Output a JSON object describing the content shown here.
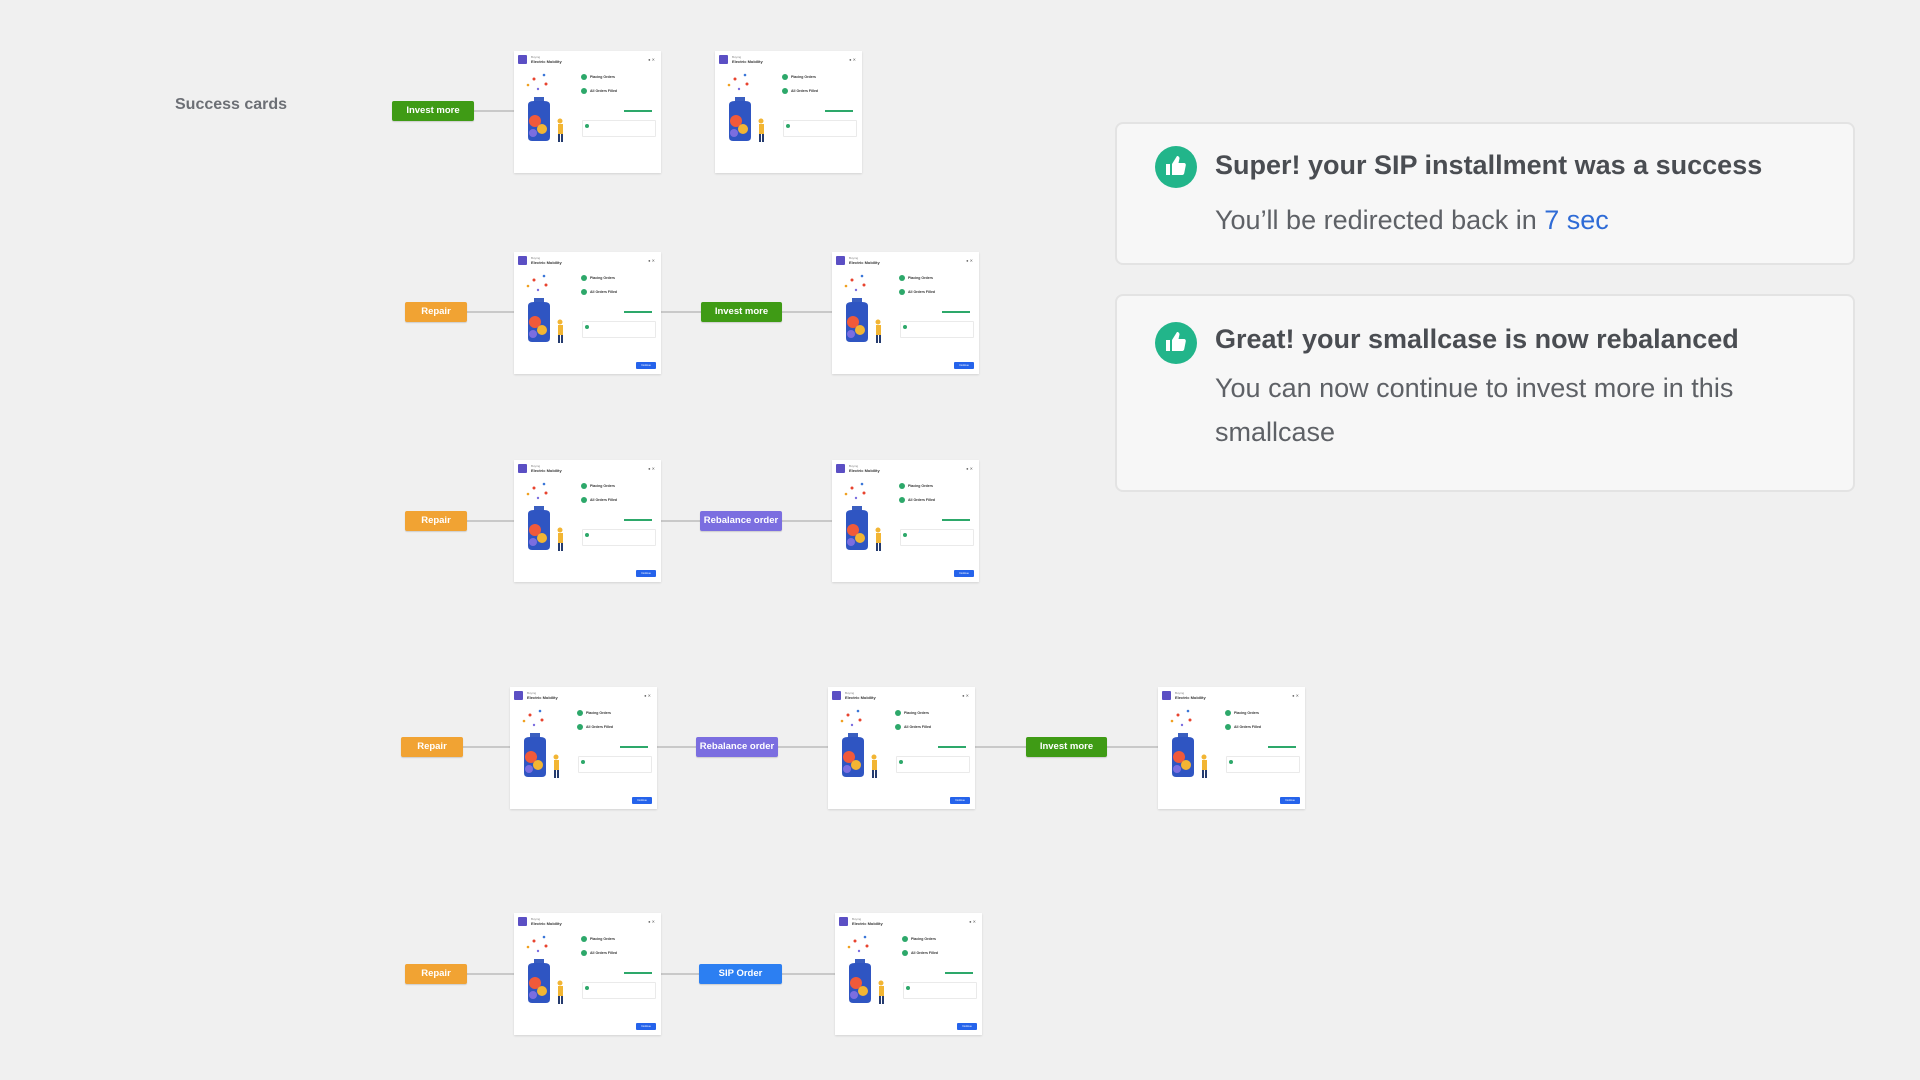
{
  "section_title": "Success cards",
  "colors": {
    "invest_more": "#3f9b15",
    "repair": "#f1a333",
    "rebalance_order": "#7b6ee0",
    "sip_order": "#2c7ff2",
    "success_icon": "#22b58a"
  },
  "card": {
    "subtitle": "Buying",
    "name": "Electric Mobility",
    "step_placing": "Placing Orders",
    "step_filled": "All Orders Filled",
    "continue_label": "Continue"
  },
  "flows": [
    {
      "steps": [
        "Invest more"
      ]
    },
    {
      "steps": [
        "Repair",
        "Invest more"
      ]
    },
    {
      "steps": [
        "Repair",
        "Rebalance order"
      ]
    },
    {
      "steps": [
        "Repair",
        "Rebalance order",
        "Invest more"
      ]
    },
    {
      "steps": [
        "Repair",
        "SIP Order"
      ]
    }
  ],
  "toasts": [
    {
      "title": "Super! your SIP installment was a success",
      "body_prefix": "You’ll be redirected back in ",
      "body_highlight": "7 sec",
      "icon": "thumbs-up-icon"
    },
    {
      "title": "Great! your smallcase is now rebalanced",
      "body": "You can now continue to invest more in this smallcase",
      "icon": "thumbs-up-icon"
    }
  ]
}
